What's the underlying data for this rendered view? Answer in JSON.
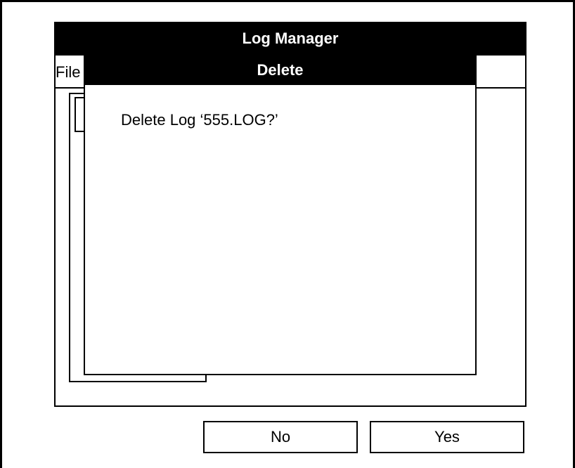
{
  "window": {
    "title": "Log Manager"
  },
  "menubar": {
    "file_label": "File"
  },
  "dialog": {
    "title": "Delete",
    "message": "Delete Log ‘555.LOG?’"
  },
  "buttons": {
    "no_label": "No",
    "yes_label": "Yes"
  }
}
